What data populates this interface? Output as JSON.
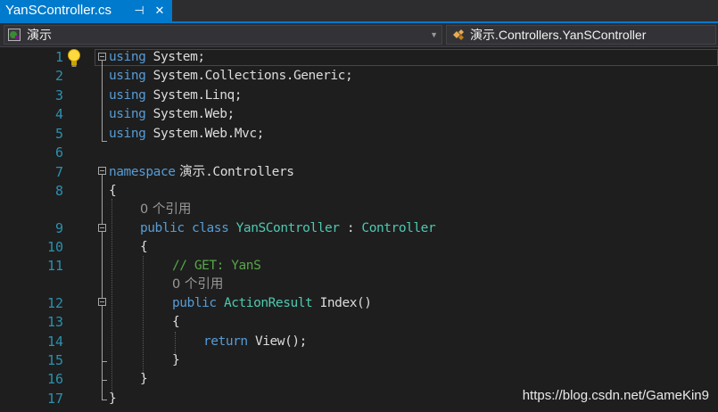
{
  "tab": {
    "filename": "YanSController.cs",
    "pin_glyph": "⊣",
    "close_glyph": "✕"
  },
  "navbar": {
    "project": "演示",
    "member": "演示.Controllers.YanSController",
    "drop_glyph": "▼"
  },
  "code": {
    "line_numbers": [
      "1",
      "2",
      "3",
      "4",
      "5",
      "6",
      "7",
      "8",
      "9",
      "10",
      "11",
      "12",
      "13",
      "14",
      "15",
      "16",
      "17"
    ],
    "l1_kw": "using",
    "l1_rest": " System;",
    "l2_kw": "using",
    "l2_rest": " System.Collections.Generic;",
    "l3_kw": "using",
    "l3_rest": " System.Linq;",
    "l4_kw": "using",
    "l4_rest": " System.Web;",
    "l5_kw": "using",
    "l5_rest": " System.Web.Mvc;",
    "l7_kw": "namespace",
    "l7_ns": " 演示",
    "l7_rest": ".Controllers",
    "l8": "{",
    "lens_class": "0 个引用",
    "l9_public": "public",
    "l9_class": " class",
    "l9_name": "YanSController",
    "l9_colon": " : ",
    "l9_base": "Controller",
    "l10": "{",
    "l11_comment": "// GET: YanS",
    "lens_method": "0 个引用",
    "l12_public": "public",
    "l12_type": "ActionResult",
    "l12_sig": " Index()",
    "l13": "{",
    "l14_return": "return",
    "l14_call": " View();",
    "l15": "}",
    "l16": "}",
    "l17": "}"
  },
  "watermark": "https://blog.csdn.net/GameKin9",
  "colors": {
    "accent": "#007acc",
    "keyword": "#569cd6",
    "type": "#4ec9b0",
    "comment": "#57a64a",
    "line_number": "#2b91af"
  }
}
